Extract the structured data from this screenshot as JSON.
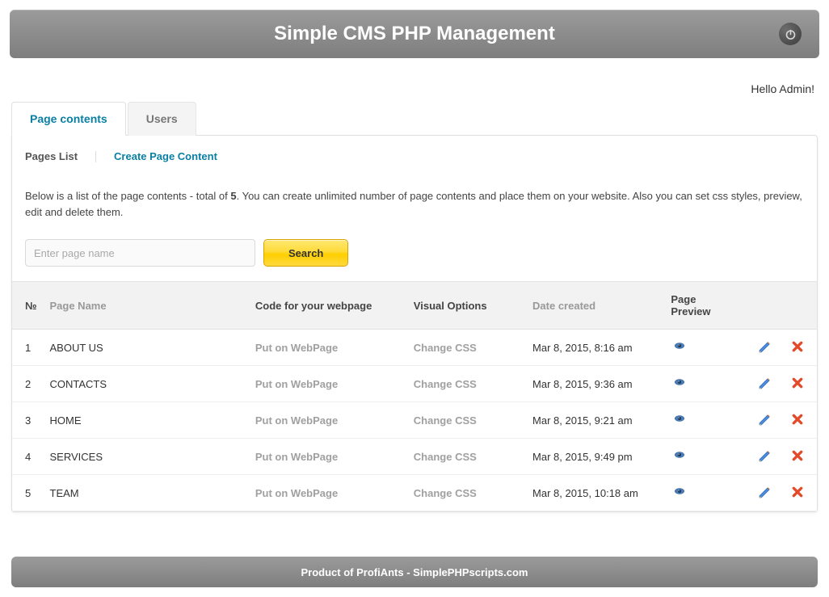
{
  "app_title": "Simple CMS PHP Management",
  "greeting": "Hello Admin!",
  "tabs": {
    "page_contents": "Page contents",
    "users": "Users"
  },
  "subnav": {
    "pages_list": "Pages List",
    "create": "Create Page Content"
  },
  "intro": {
    "prefix": "Below is a list of the page contents - total of ",
    "count": "5",
    "suffix": ".   You can create unlimited number of page contents and place them on your website. Also you can set css styles, preview, edit and delete them."
  },
  "search": {
    "placeholder": "Enter page name",
    "button": "Search"
  },
  "table": {
    "headers": {
      "num": "№",
      "page_name": "Page Name",
      "code": "Code for your webpage",
      "visual": "Visual Options",
      "date": "Date created",
      "preview": "Page Preview"
    },
    "code_label": "Put on WebPage",
    "visual_label": "Change CSS",
    "rows": [
      {
        "n": "1",
        "name": "ABOUT US",
        "date": "Mar 8, 2015, 8:16 am"
      },
      {
        "n": "2",
        "name": "CONTACTS",
        "date": "Mar 8, 2015, 9:36 am"
      },
      {
        "n": "3",
        "name": "HOME",
        "date": "Mar 8, 2015, 9:21 am"
      },
      {
        "n": "4",
        "name": "SERVICES",
        "date": "Mar 8, 2015, 9:49 pm"
      },
      {
        "n": "5",
        "name": "TEAM",
        "date": "Mar 8, 2015, 10:18 am"
      }
    ]
  },
  "footer": "Product of ProfiAnts - SimplePHPscripts.com"
}
